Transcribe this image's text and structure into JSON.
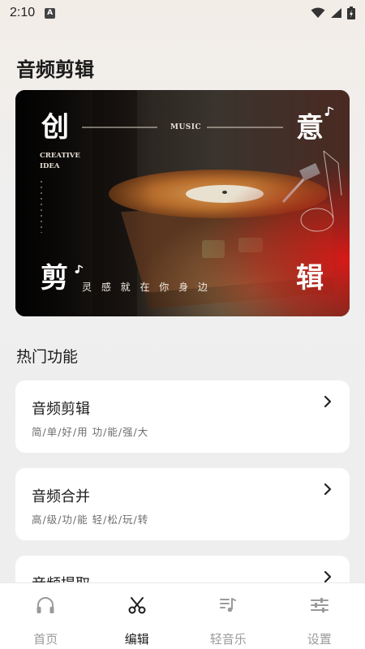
{
  "status": {
    "time": "2:10",
    "notification_glyph": "A"
  },
  "page": {
    "title": "音频剪辑"
  },
  "banner": {
    "char_1": "创",
    "char_2": "意",
    "char_3": "剪",
    "char_4": "辑",
    "music_label": "MUSIC",
    "creative_line1": "CREATIVE",
    "creative_line2": "IDEA",
    "slogan": "灵 感 就 在 你 身 边"
  },
  "section": {
    "title": "热门功能"
  },
  "cards": [
    {
      "title": "音频剪辑",
      "subtitle": "简/单/好/用 功/能/强/大"
    },
    {
      "title": "音频合并",
      "subtitle": "高/级/功/能 轻/松/玩/转"
    },
    {
      "title": "音频提取",
      "subtitle": ""
    }
  ],
  "nav": [
    {
      "label": "首页",
      "icon": "headphones-icon",
      "active": false
    },
    {
      "label": "编辑",
      "icon": "scissors-icon",
      "active": true
    },
    {
      "label": "轻音乐",
      "icon": "music-list-icon",
      "active": false
    },
    {
      "label": "设置",
      "icon": "sliders-icon",
      "active": false
    }
  ],
  "colors": {
    "accent_active": "#1c1c1c",
    "inactive": "#9a9a9a",
    "card_bg": "#ffffff"
  }
}
